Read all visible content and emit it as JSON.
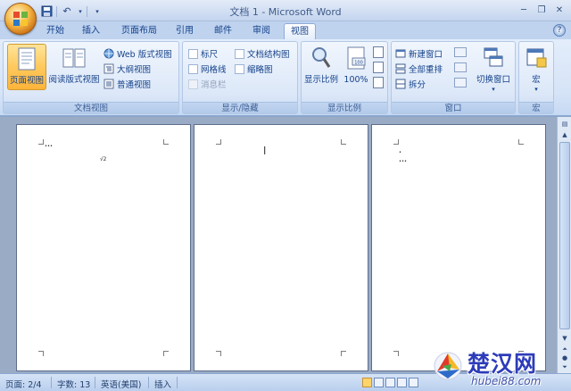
{
  "window": {
    "title": "文档 1 - Microsoft Word"
  },
  "tabs": [
    {
      "label": "开始",
      "active": false
    },
    {
      "label": "插入",
      "active": false
    },
    {
      "label": "页面布局",
      "active": false
    },
    {
      "label": "引用",
      "active": false
    },
    {
      "label": "邮件",
      "active": false
    },
    {
      "label": "审阅",
      "active": false
    },
    {
      "label": "视图",
      "active": true
    }
  ],
  "ribbon": {
    "doc_views": {
      "label": "文档视图",
      "print_layout": "页面视图",
      "reading_layout": "阅读版式视图",
      "web_layout": "Web 版式视图",
      "outline": "大纲视图",
      "draft": "普通视图"
    },
    "show_hide": {
      "label": "显示/隐藏",
      "ruler": "标尺",
      "gridlines": "网格线",
      "message_bar": "消息栏",
      "doc_map": "文档结构图",
      "thumbnails": "缩略图"
    },
    "zoom": {
      "label": "显示比例",
      "zoom_btn": "显示比例",
      "hundred": "100%",
      "hundred_icon_text": "100"
    },
    "window_group": {
      "label": "窗口",
      "new_window": "新建窗口",
      "arrange_all": "全部重排",
      "split": "拆分",
      "switch_windows": "切换窗口"
    },
    "macros": {
      "label": "宏",
      "macros_btn": "宏"
    }
  },
  "status": {
    "page": "页面: 2/4",
    "words": "字数: 13",
    "language": "英语(美国)",
    "mode": "插入"
  },
  "watermark": {
    "name": "楚汉网",
    "url": "hubei88.com"
  },
  "pages": [
    {
      "snippets": [
        "•••",
        "√2"
      ]
    },
    {
      "snippets": [
        "|"
      ]
    },
    {
      "snippets": [
        "•",
        "•••"
      ]
    }
  ],
  "colors": {
    "accent": "#15428b",
    "selected": "#ffc95c",
    "brand_blue": "#2d3cb9"
  }
}
